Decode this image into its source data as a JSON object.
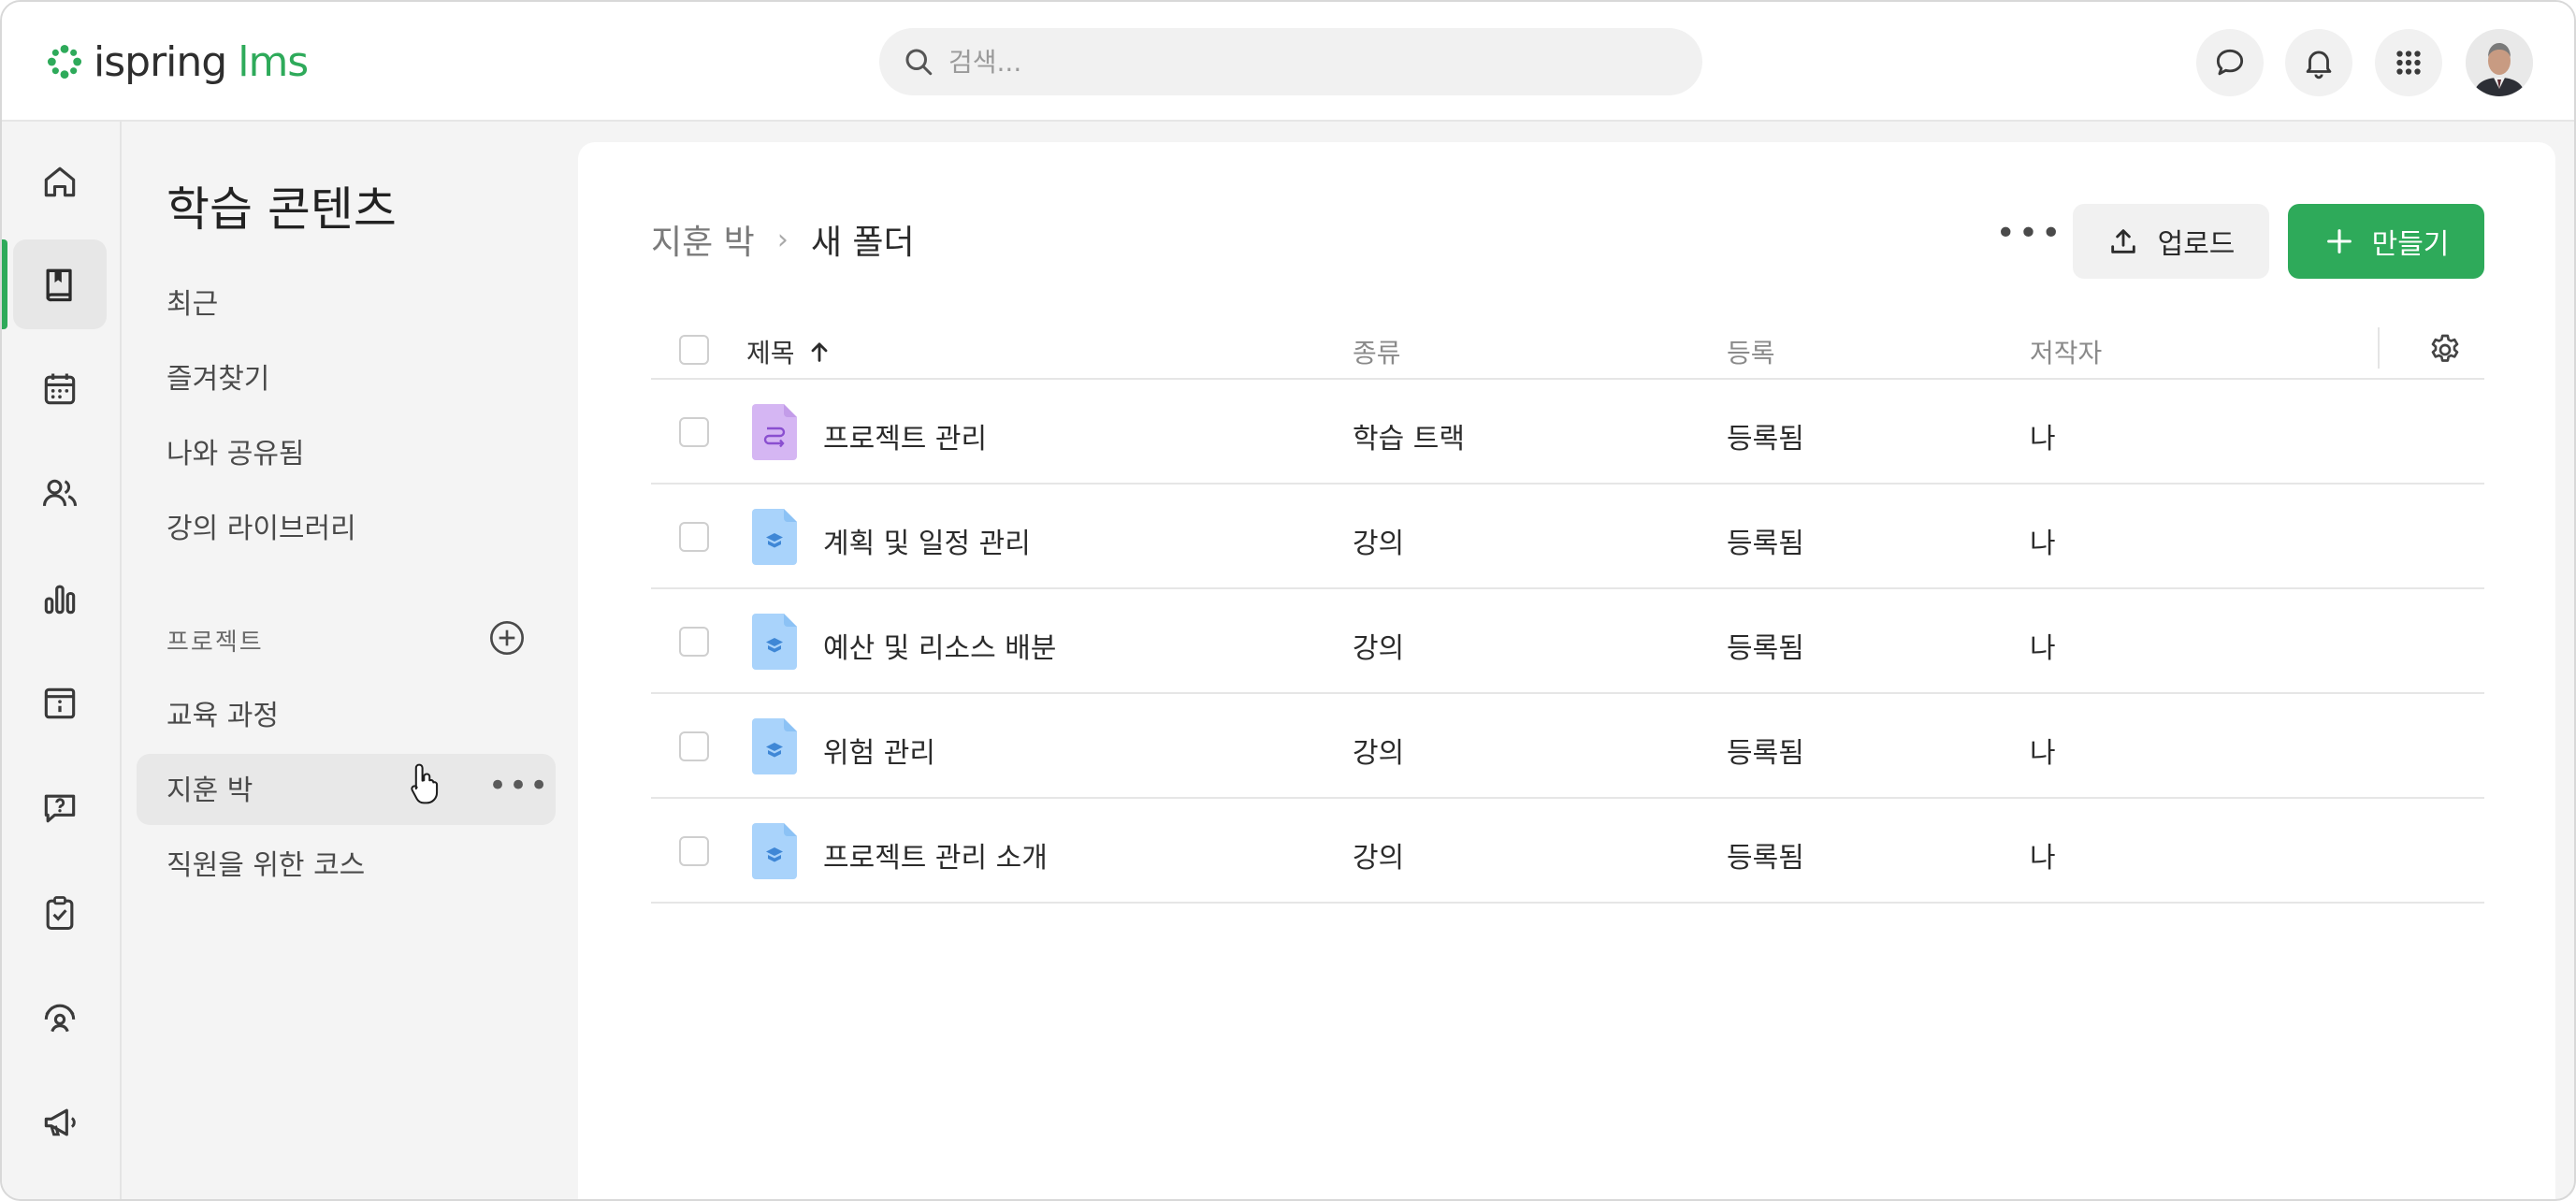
{
  "header": {
    "logo_brand": "ispring",
    "logo_product": "lms",
    "search_placeholder": "검색...",
    "brand_color": "#2eaa5a"
  },
  "rail": {
    "items": [
      {
        "icon": "home-icon"
      },
      {
        "icon": "book-icon",
        "active": true
      },
      {
        "icon": "calendar-icon"
      },
      {
        "icon": "users-icon"
      },
      {
        "icon": "bar-chart-icon"
      },
      {
        "icon": "info-board-icon"
      },
      {
        "icon": "question-chat-icon"
      },
      {
        "icon": "clipboard-check-icon"
      },
      {
        "icon": "user-gauge-icon"
      },
      {
        "icon": "megaphone-icon"
      }
    ]
  },
  "sidebar": {
    "title": "학습 콘텐츠",
    "links": [
      "최근",
      "즐겨찾기",
      "나와 공유됨",
      "강의 라이브러리"
    ],
    "section_label": "프로젝트",
    "folders": [
      "교육 과정",
      "지훈 박",
      "직원을 위한 코스"
    ],
    "more_label": "•••"
  },
  "main": {
    "breadcrumb_root": "지훈 박",
    "breadcrumb_sep": "›",
    "breadcrumb_current": "새 폴더",
    "more_label": "•••",
    "upload_label": "업로드",
    "create_label": "만들기",
    "columns": {
      "title": "제목",
      "type": "종류",
      "enrollment": "등록",
      "author": "저작자"
    },
    "rows": [
      {
        "title": "프로젝트 관리",
        "type": "학습 트랙",
        "enrollment": "등록됨",
        "author": "나",
        "icon": "learning-track-icon"
      },
      {
        "title": "계획 및 일정 관리",
        "type": "강의",
        "enrollment": "등록됨",
        "author": "나",
        "icon": "course-icon"
      },
      {
        "title": "예산 및 리소스 배분",
        "type": "강의",
        "enrollment": "등록됨",
        "author": "나",
        "icon": "course-icon"
      },
      {
        "title": "위험 관리",
        "type": "강의",
        "enrollment": "등록됨",
        "author": "나",
        "icon": "course-icon"
      },
      {
        "title": "프로젝트 관리 소개",
        "type": "강의",
        "enrollment": "등록됨",
        "author": "나",
        "icon": "course-icon"
      }
    ]
  }
}
